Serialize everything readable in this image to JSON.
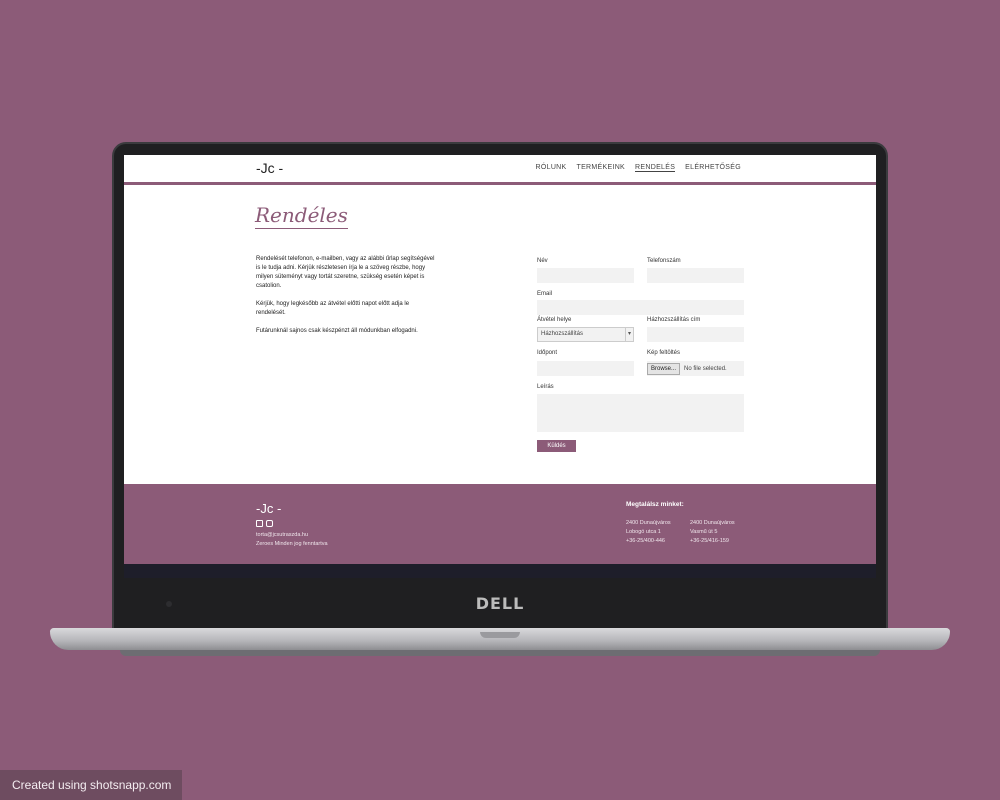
{
  "site": {
    "logo": "-Jc -",
    "nav": [
      "RÓLUNK",
      "TERMÉKEINK",
      "RENDELÉS",
      "ELÉRHETŐSÉG"
    ],
    "nav_active": "RENDELÉS",
    "page_title": "Rendéles"
  },
  "intro": {
    "p1": "Rendelését telefonon, e-mailben, vagy az alábbi űrlap segítségével is le tudja adni. Kérjük részletesen írja le a szöveg részbe, hogy milyen süteményt vagy tortát szeretne, szükség esetén képet is csatolion.",
    "p2": "Kérjük, hogy legkésőbb az átvétel előtti napot előtt adja le rendelését.",
    "p3": "Futárunknál sajnos csak készpénzt áll módunkban elfogadni."
  },
  "form": {
    "name_label": "Név",
    "phone_label": "Telefonszám",
    "email_label": "Email",
    "place_label": "Átvétel helye",
    "place_value": "Házhozszállítás",
    "delivery_label": "Házhozszállítás cím",
    "time_label": "Időpont",
    "image_label": "Kép feltöltés",
    "browse_label": "Browse...",
    "no_file_label": "No file selected.",
    "desc_label": "Leírás",
    "submit_label": "Küldés"
  },
  "footer": {
    "logo": "-Jc -",
    "email": "torta@jcsutraszda.hu",
    "copyright": "Zeroes Minden jog fenntartva",
    "find_us": "Megtalálsz minket:",
    "addr1_line1": "2400 Dunaújváros",
    "addr1_line2": "Lobogó utca 1",
    "addr1_line3": "+36-25/400-446",
    "addr2_line1": "2400 Dunaújváros",
    "addr2_line2": "Vasmű út 5",
    "addr2_line3": "+36-25/416-159"
  },
  "laptop": {
    "brand": "DELL"
  },
  "watermark": "Created using shotsnapp.com",
  "colors": {
    "accent": "#8c5b78",
    "background": "#8c5b78",
    "footer_strip": "#1e1e2a"
  },
  "icons": [
    "facebook-icon",
    "instagram-icon"
  ]
}
